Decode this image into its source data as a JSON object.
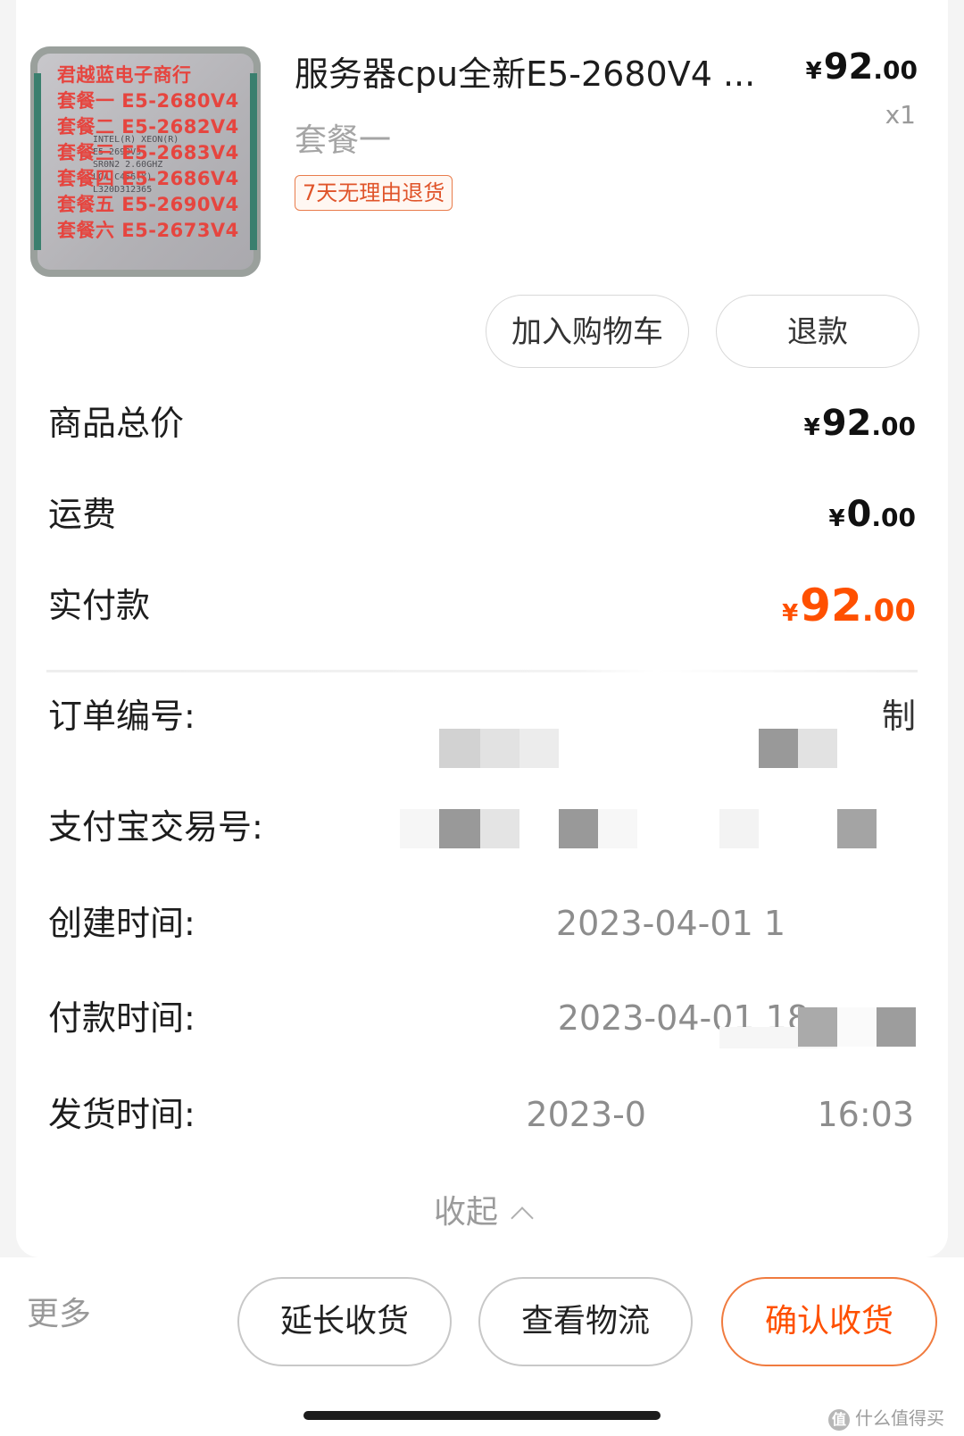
{
  "product": {
    "image_watermark_lines": [
      "君越蓝电子商行",
      "套餐一  E5-2680V4",
      "套餐二  E5-2682V4",
      "套餐三  E5-2683V4",
      "套餐四  E5-2686V4",
      "套餐五  E5-2690V4",
      "套餐六  E5-2673V4"
    ],
    "chip_lines": [
      "INTEL(R) XEON(R)",
      "E5-2690V3",
      "SR0N2 2.60GHZ",
      "LGA C456(Y)",
      "L320D312365"
    ],
    "title": "服务器cpu全新E5-2680V4 ...",
    "variant": "套餐一",
    "tag": "7天无理由退货",
    "price_int": "92",
    "price_dec": ".00",
    "currency": "¥",
    "qty": "x1"
  },
  "actions": {
    "add_to_cart": "加入购物车",
    "refund": "退款"
  },
  "summary": {
    "goods_total_label": "商品总价",
    "goods_total_int": "92",
    "goods_total_dec": ".00",
    "shipping_label": "运费",
    "shipping_int": "0",
    "shipping_dec": ".00",
    "paid_label": "实付款",
    "paid_int": "92",
    "paid_dec": ".00"
  },
  "details": {
    "order_no_label": "订单编号:",
    "order_no_copy": "制",
    "alipay_no_label": "支付宝交易号:",
    "created_label": "创建时间:",
    "created_value": "2023-04-01 1",
    "paid_time_label": "付款时间:",
    "paid_time_value": "2023-04-01 18",
    "shipped_label": "发货时间:",
    "shipped_value_a": "2023-0",
    "shipped_value_b": "16:03",
    "collapse_label": "收起"
  },
  "bottom": {
    "more": "更多",
    "extend": "延长收货",
    "logistics": "查看物流",
    "confirm": "确认收货",
    "watermark": "什么值得买",
    "watermark_logo": "值"
  },
  "colors": {
    "accent": "#ff5000",
    "tag_border": "#e97c4c"
  }
}
